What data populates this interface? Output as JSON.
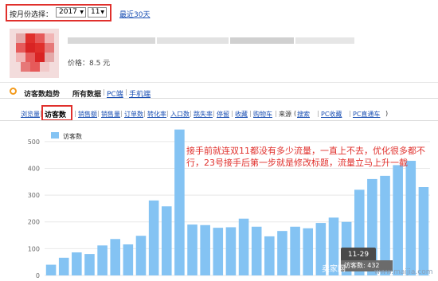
{
  "filter": {
    "label": "按月份选择：",
    "year_value": "2017",
    "month_value": "11",
    "recent_link": "最近30天"
  },
  "product": {
    "price": "价格：8.5 元"
  },
  "section": {
    "title": "访客数趋势",
    "tabs": [
      "所有数据",
      "PC端",
      "手机端"
    ]
  },
  "metric_tabs": {
    "before": [
      "浏览量"
    ],
    "active": "访客数",
    "after": [
      "销售额",
      "销售量",
      "订单数",
      "转化率",
      "入口数",
      "跳失率",
      "停留",
      "收藏",
      "购物车"
    ],
    "source_label": "来源",
    "sources": [
      "搜索",
      "PC收藏",
      "PC直通车"
    ]
  },
  "chart_data": {
    "type": "bar",
    "legend": "访客数",
    "ylim": [
      0,
      550
    ],
    "yticks": [
      0,
      100,
      200,
      300,
      400,
      500
    ],
    "series": [
      {
        "name": "访客数",
        "values": [
          40,
          66,
          86,
          80,
          112,
          136,
          116,
          148,
          280,
          258,
          545,
          190,
          188,
          178,
          180,
          212,
          182,
          146,
          166,
          182,
          176,
          196,
          216,
          200,
          320,
          360,
          372,
          412,
          428,
          330
        ]
      }
    ],
    "bar_color": "#84c3f3",
    "grid": true
  },
  "annotation": "接手前就连双11都没有多少流量，一直上不去，优化很多都不行，23号接手后第一步就是修改标题，流量立马上升一截",
  "tooltip": {
    "date": "11-29",
    "row": "访客数: 432"
  },
  "watermark": {
    "text": "卖家网",
    "site": "www.maijia.com"
  },
  "colors": {
    "accent_red": "#e0302c",
    "link_blue": "#1a4fb3",
    "bar": "#84c3f3"
  }
}
